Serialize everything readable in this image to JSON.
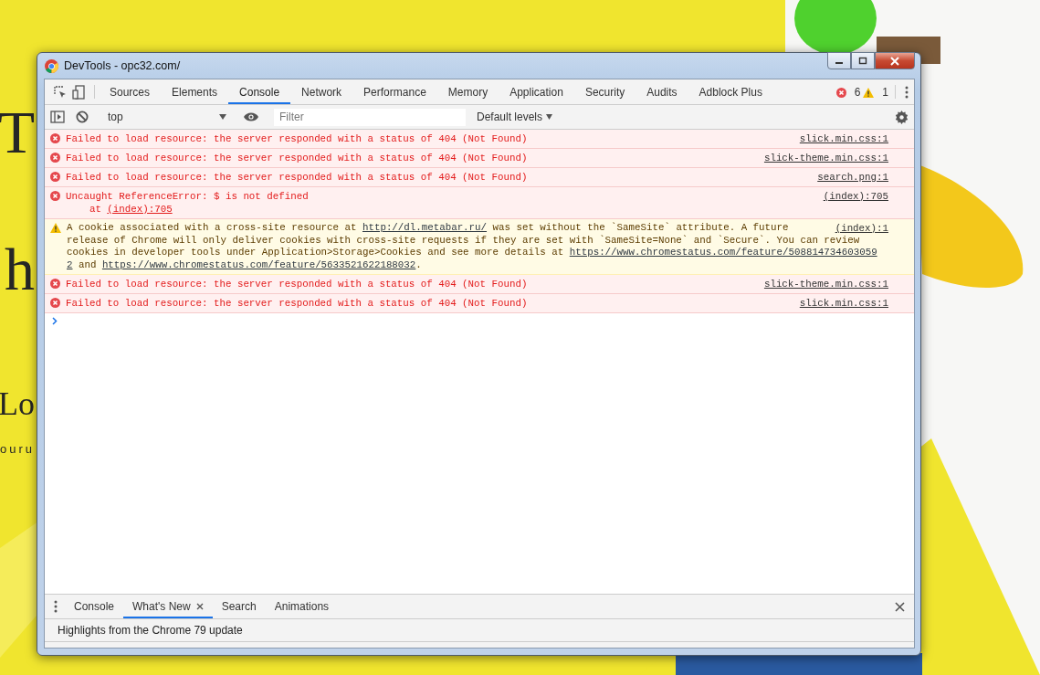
{
  "page_behind": {
    "fragments": [
      "T",
      "h",
      "Lo",
      "ouru"
    ]
  },
  "window": {
    "title": "DevTools - opc32.com/"
  },
  "main_tabs": [
    {
      "label": "Sources",
      "selected": false
    },
    {
      "label": "Elements",
      "selected": false
    },
    {
      "label": "Console",
      "selected": true
    },
    {
      "label": "Network",
      "selected": false
    },
    {
      "label": "Performance",
      "selected": false
    },
    {
      "label": "Memory",
      "selected": false
    },
    {
      "label": "Application",
      "selected": false
    },
    {
      "label": "Security",
      "selected": false
    },
    {
      "label": "Audits",
      "selected": false
    },
    {
      "label": "Adblock Plus",
      "selected": false
    }
  ],
  "counts": {
    "errors": "6",
    "warnings": "1"
  },
  "toolbar": {
    "context": "top",
    "filter_placeholder": "Filter",
    "levels": "Default levels"
  },
  "messages": [
    {
      "kind": "error",
      "lines": [
        [
          {
            "text": "Failed to load resource: the server responded with a status of 404 (Not Found)",
            "link": false
          }
        ]
      ],
      "source": "slick.min.css:1"
    },
    {
      "kind": "error",
      "lines": [
        [
          {
            "text": "Failed to load resource: the server responded with a status of 404 (Not Found)",
            "link": false
          }
        ]
      ],
      "source": "slick-theme.min.css:1"
    },
    {
      "kind": "error",
      "lines": [
        [
          {
            "text": "Failed to load resource: the server responded with a status of 404 (Not Found)",
            "link": false
          }
        ]
      ],
      "source": "search.png:1"
    },
    {
      "kind": "error",
      "lines": [
        [
          {
            "text": "Uncaught ReferenceError: $ is not defined",
            "link": false
          }
        ],
        [
          {
            "text": "    at ",
            "link": false
          },
          {
            "text": "(index):705",
            "link": true
          }
        ]
      ],
      "source": "(index):705"
    },
    {
      "kind": "warning",
      "lines": [
        [
          {
            "text": "A cookie associated with a cross-site resource at ",
            "link": false
          },
          {
            "text": "http://dl.metabar.ru/",
            "link": true
          },
          {
            "text": " was set without the `SameSite` attribute. A future",
            "link": false
          }
        ],
        [
          {
            "text": "release of Chrome will only deliver cookies with cross-site requests if they are set with `SameSite=None` and `Secure`. You can review",
            "link": false
          }
        ],
        [
          {
            "text": "cookies in developer tools under Application>Storage>Cookies and see more details at ",
            "link": false
          },
          {
            "text": "https://www.chromestatus.com/feature/508814734603059",
            "link": true
          }
        ],
        [
          {
            "text": "2",
            "link": true
          },
          {
            "text": " and ",
            "link": false
          },
          {
            "text": "https://www.chromestatus.com/feature/5633521622188032",
            "link": true
          },
          {
            "text": ".",
            "link": false
          }
        ]
      ],
      "source": "(index):1"
    },
    {
      "kind": "error",
      "lines": [
        [
          {
            "text": "Failed to load resource: the server responded with a status of 404 (Not Found)",
            "link": false
          }
        ]
      ],
      "source": "slick-theme.min.css:1"
    },
    {
      "kind": "error",
      "lines": [
        [
          {
            "text": "Failed to load resource: the server responded with a status of 404 (Not Found)",
            "link": false
          }
        ]
      ],
      "source": "slick.min.css:1"
    }
  ],
  "drawer": {
    "tabs": [
      {
        "label": "Console",
        "selected": false,
        "closable": false
      },
      {
        "label": "What's New",
        "selected": true,
        "closable": true
      },
      {
        "label": "Search",
        "selected": false,
        "closable": false
      },
      {
        "label": "Animations",
        "selected": false,
        "closable": false
      }
    ],
    "content": "Highlights from the Chrome 79 update"
  }
}
